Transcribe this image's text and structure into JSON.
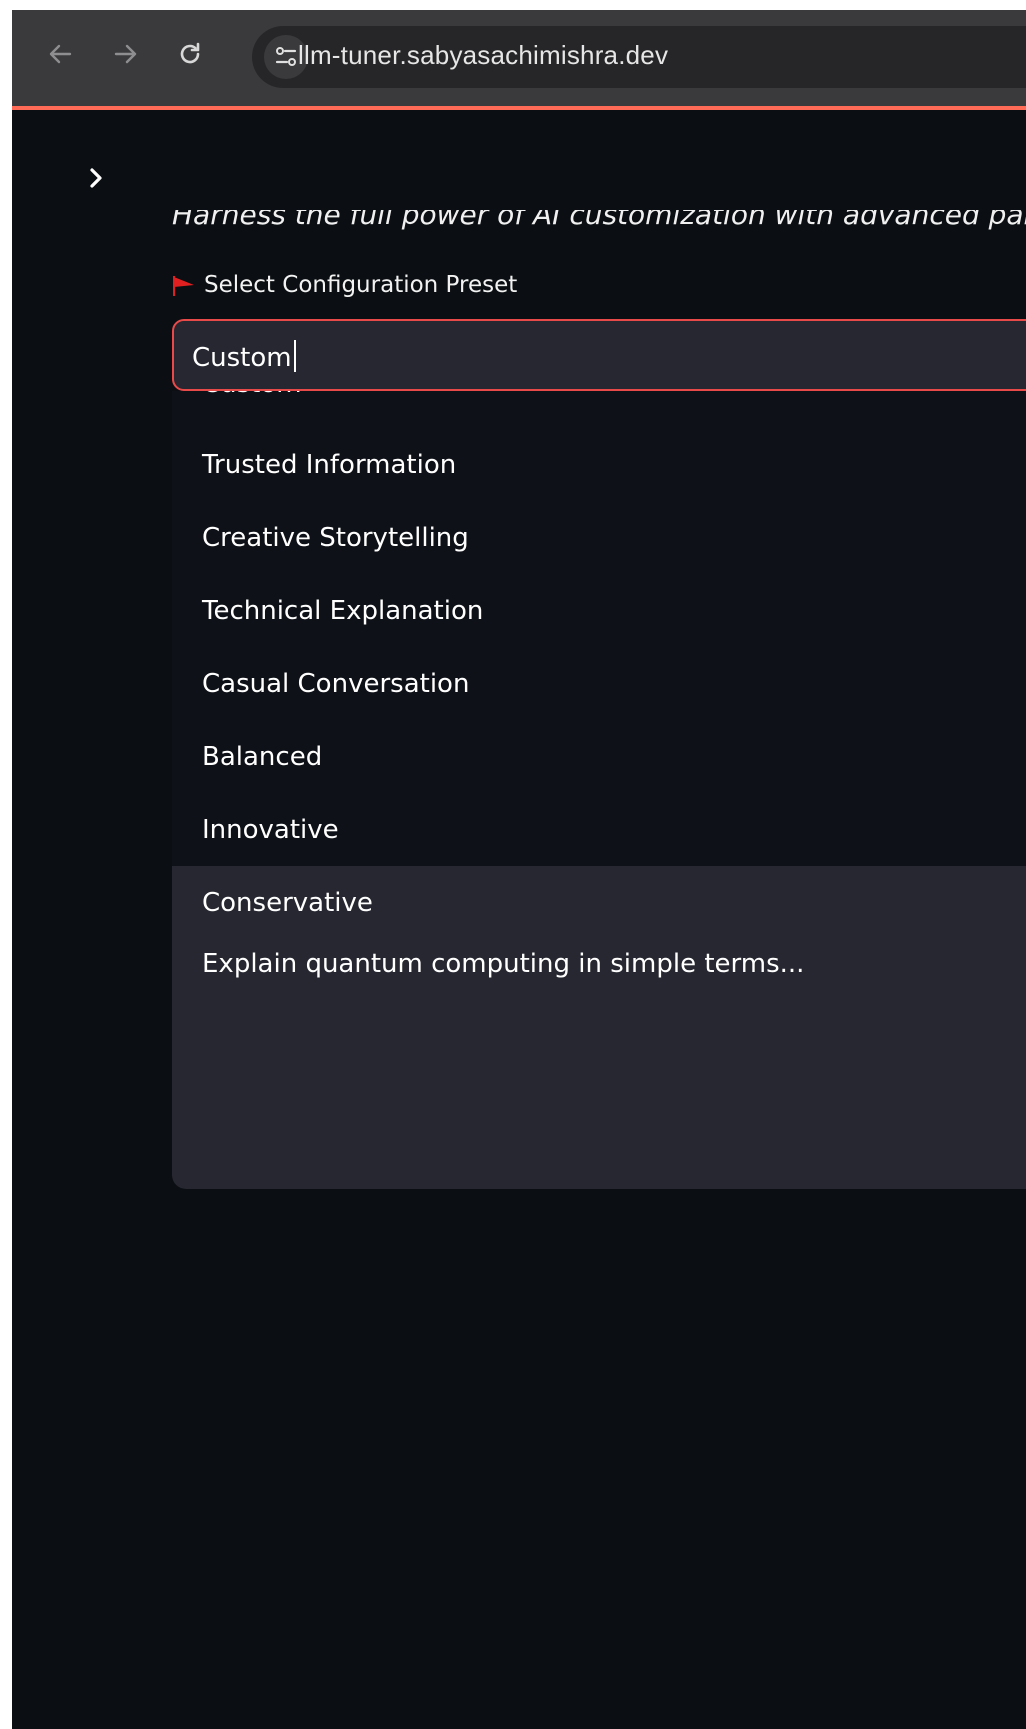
{
  "browser": {
    "url": "llm-tuner.sabyasachimishra.dev",
    "accent_color": "#ff6b57"
  },
  "app": {
    "tagline": "Harness the full power of AI customization with advanced parame",
    "preset_label": "Select Configuration Preset",
    "preset_input_value": "Custom",
    "preset_options": [
      "Custom",
      "Trusted Information",
      "Creative Storytelling",
      "Technical Explanation",
      "Casual Conversation",
      "Balanced",
      "Innovative",
      "Conservative"
    ],
    "highlighted_option": "Conservative",
    "prompt_text": "Explain quantum computing in simple terms...",
    "colors": {
      "background": "#0e1117",
      "input_border": "#e84a4a",
      "panel": "#262730",
      "flag": "#e02020"
    },
    "icons": [
      "back-arrow-icon",
      "forward-arrow-icon",
      "reload-icon",
      "site-settings-icon",
      "chevron-right-icon",
      "flag-icon"
    ]
  }
}
